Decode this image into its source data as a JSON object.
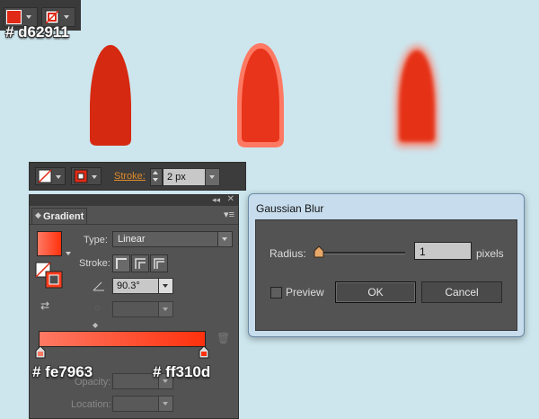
{
  "fill_stroke_widget": {
    "fill_color": "#e02a16",
    "stroke_state": "none"
  },
  "labels": {
    "nail_color": "# d62911",
    "gradient_start": "# fe7963",
    "gradient_end": "# ff310d"
  },
  "shapes": [
    {
      "name": "flat-nail",
      "fill": "#d62911"
    },
    {
      "name": "gradient-nail",
      "fill": "#ff310d",
      "stroke": "#fe7963"
    },
    {
      "name": "blurred-nail",
      "fill": "#e53118"
    }
  ],
  "stroke_bar": {
    "stroke_label": "Stroke:",
    "stroke_value": "2 px"
  },
  "gradient_panel": {
    "title": "Gradient",
    "type_label": "Type:",
    "type_value": "Linear",
    "stroke_label": "Stroke:",
    "angle_value": "90.3°",
    "opacity_label": "Opacity:",
    "location_label": "Location:",
    "colors": {
      "start": "#fe7963",
      "end": "#ff310d"
    }
  },
  "gaussian_blur": {
    "title": "Gaussian Blur",
    "radius_label": "Radius:",
    "radius_value": "1",
    "unit": "pixels",
    "preview_label": "Preview",
    "preview_checked": false,
    "ok_label": "OK",
    "cancel_label": "Cancel"
  }
}
